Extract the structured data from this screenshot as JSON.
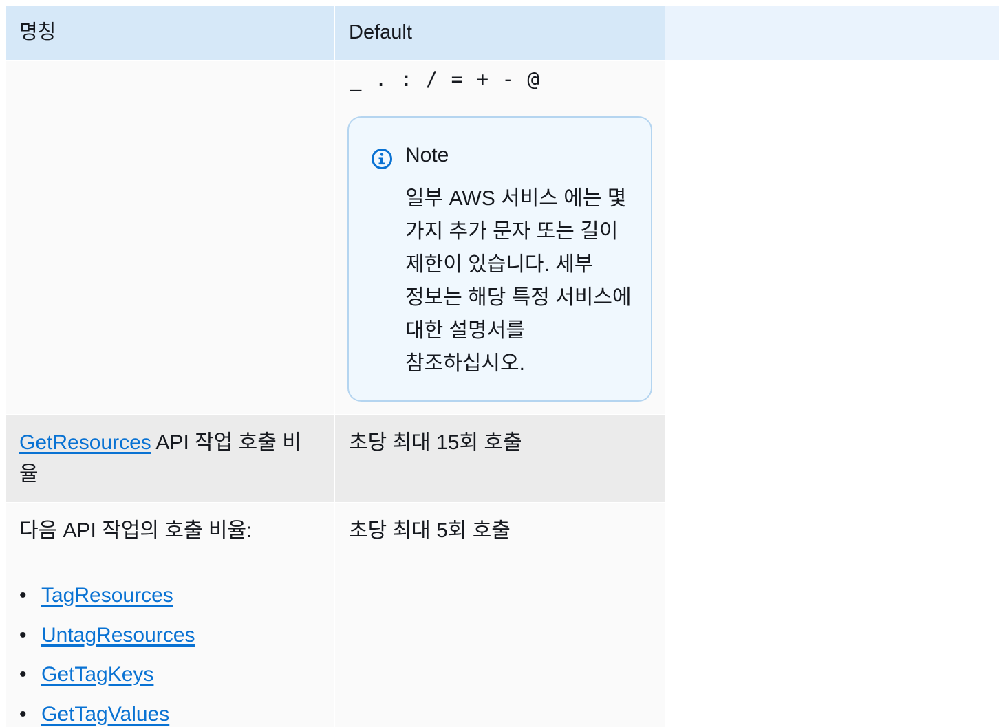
{
  "table": {
    "headers": [
      "명칭",
      "Default"
    ],
    "rows": [
      {
        "allowed_chars": "_ . : / = + - @",
        "note": {
          "title": "Note",
          "body": "일부 AWS 서비스 에는 몇 가지 추가 문자 또는 길이 제한이 있습니다. 세부 정보는 해당 특정 서비스에 대한 설명서를 참조하십시오."
        }
      },
      {
        "name_link": "GetResources",
        "name_suffix": " API 작업 호출 비율",
        "value": "초당 최대 15회 호출"
      },
      {
        "name": "다음 API 작업의 호출 비율:",
        "list": [
          "TagResources",
          "UntagResources",
          "GetTagKeys",
          "GetTagValues"
        ],
        "value": "초당 최대 5회 호출"
      }
    ]
  },
  "colors": {
    "header_bg": "#d6e8f8",
    "link": "#0972d3",
    "note_border": "#b5d5f0",
    "note_icon": "#0972d3"
  }
}
